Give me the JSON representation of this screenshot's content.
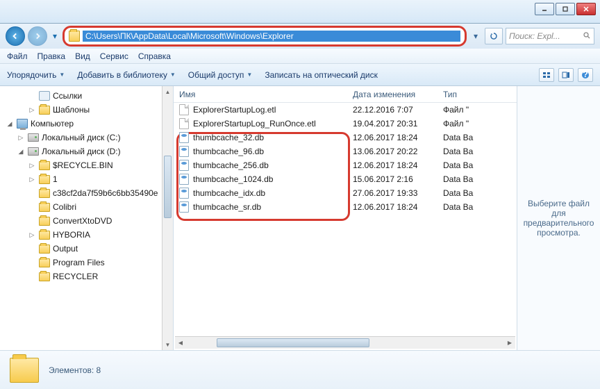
{
  "address_path": "C:\\Users\\ПК\\AppData\\Local\\Microsoft\\Windows\\Explorer",
  "search_placeholder": "Поиск: Expl...",
  "menubar": {
    "file": "Файл",
    "edit": "Правка",
    "view": "Вид",
    "tools": "Сервис",
    "help": "Справка"
  },
  "toolbar": {
    "organize": "Упорядочить",
    "add_library": "Добавить в библиотеку",
    "share": "Общий доступ",
    "burn": "Записать на оптический диск"
  },
  "tree": [
    {
      "indent": 2,
      "twist": "",
      "icon": "link",
      "label": "Ссылки"
    },
    {
      "indent": 2,
      "twist": "▷",
      "icon": "folder",
      "label": "Шаблоны"
    },
    {
      "indent": 0,
      "twist": "◢",
      "icon": "comp",
      "label": "Компьютер"
    },
    {
      "indent": 1,
      "twist": "▷",
      "icon": "drive",
      "label": "Локальный диск (C:)"
    },
    {
      "indent": 1,
      "twist": "◢",
      "icon": "drive",
      "label": "Локальный диск (D:)"
    },
    {
      "indent": 2,
      "twist": "▷",
      "icon": "folder",
      "label": "$RECYCLE.BIN"
    },
    {
      "indent": 2,
      "twist": "▷",
      "icon": "folder",
      "label": "1"
    },
    {
      "indent": 2,
      "twist": "",
      "icon": "folder",
      "label": "c38cf2da7f59b6c6bb35490e"
    },
    {
      "indent": 2,
      "twist": "",
      "icon": "folder",
      "label": "Colibri"
    },
    {
      "indent": 2,
      "twist": "",
      "icon": "folder",
      "label": "ConvertXtoDVD"
    },
    {
      "indent": 2,
      "twist": "▷",
      "icon": "folder",
      "label": "HYBORIA"
    },
    {
      "indent": 2,
      "twist": "",
      "icon": "folder",
      "label": "Output"
    },
    {
      "indent": 2,
      "twist": "",
      "icon": "folder",
      "label": "Program Files"
    },
    {
      "indent": 2,
      "twist": "",
      "icon": "folder",
      "label": "RECYCLER"
    }
  ],
  "columns": {
    "name": "Имя",
    "date": "Дата изменения",
    "type": "Тип"
  },
  "files": [
    {
      "icon": "file",
      "name": "ExplorerStartupLog.etl",
      "date": "22.12.2016 7:07",
      "type": "Файл \"",
      "hl": false
    },
    {
      "icon": "file",
      "name": "ExplorerStartupLog_RunOnce.etl",
      "date": "19.04.2017 20:31",
      "type": "Файл \"",
      "hl": false
    },
    {
      "icon": "db",
      "name": "thumbcache_32.db",
      "date": "12.06.2017 18:24",
      "type": "Data Ba",
      "hl": true
    },
    {
      "icon": "db",
      "name": "thumbcache_96.db",
      "date": "13.06.2017 20:22",
      "type": "Data Ba",
      "hl": true
    },
    {
      "icon": "db",
      "name": "thumbcache_256.db",
      "date": "12.06.2017 18:24",
      "type": "Data Ba",
      "hl": true
    },
    {
      "icon": "db",
      "name": "thumbcache_1024.db",
      "date": "15.06.2017 2:16",
      "type": "Data Ba",
      "hl": true
    },
    {
      "icon": "db",
      "name": "thumbcache_idx.db",
      "date": "27.06.2017 19:33",
      "type": "Data Ba",
      "hl": true
    },
    {
      "icon": "db",
      "name": "thumbcache_sr.db",
      "date": "12.06.2017 18:24",
      "type": "Data Ba",
      "hl": true
    }
  ],
  "preview_text": "Выберите файл для предварительного просмотра.",
  "status_label": "Элементов:",
  "status_count": "8"
}
